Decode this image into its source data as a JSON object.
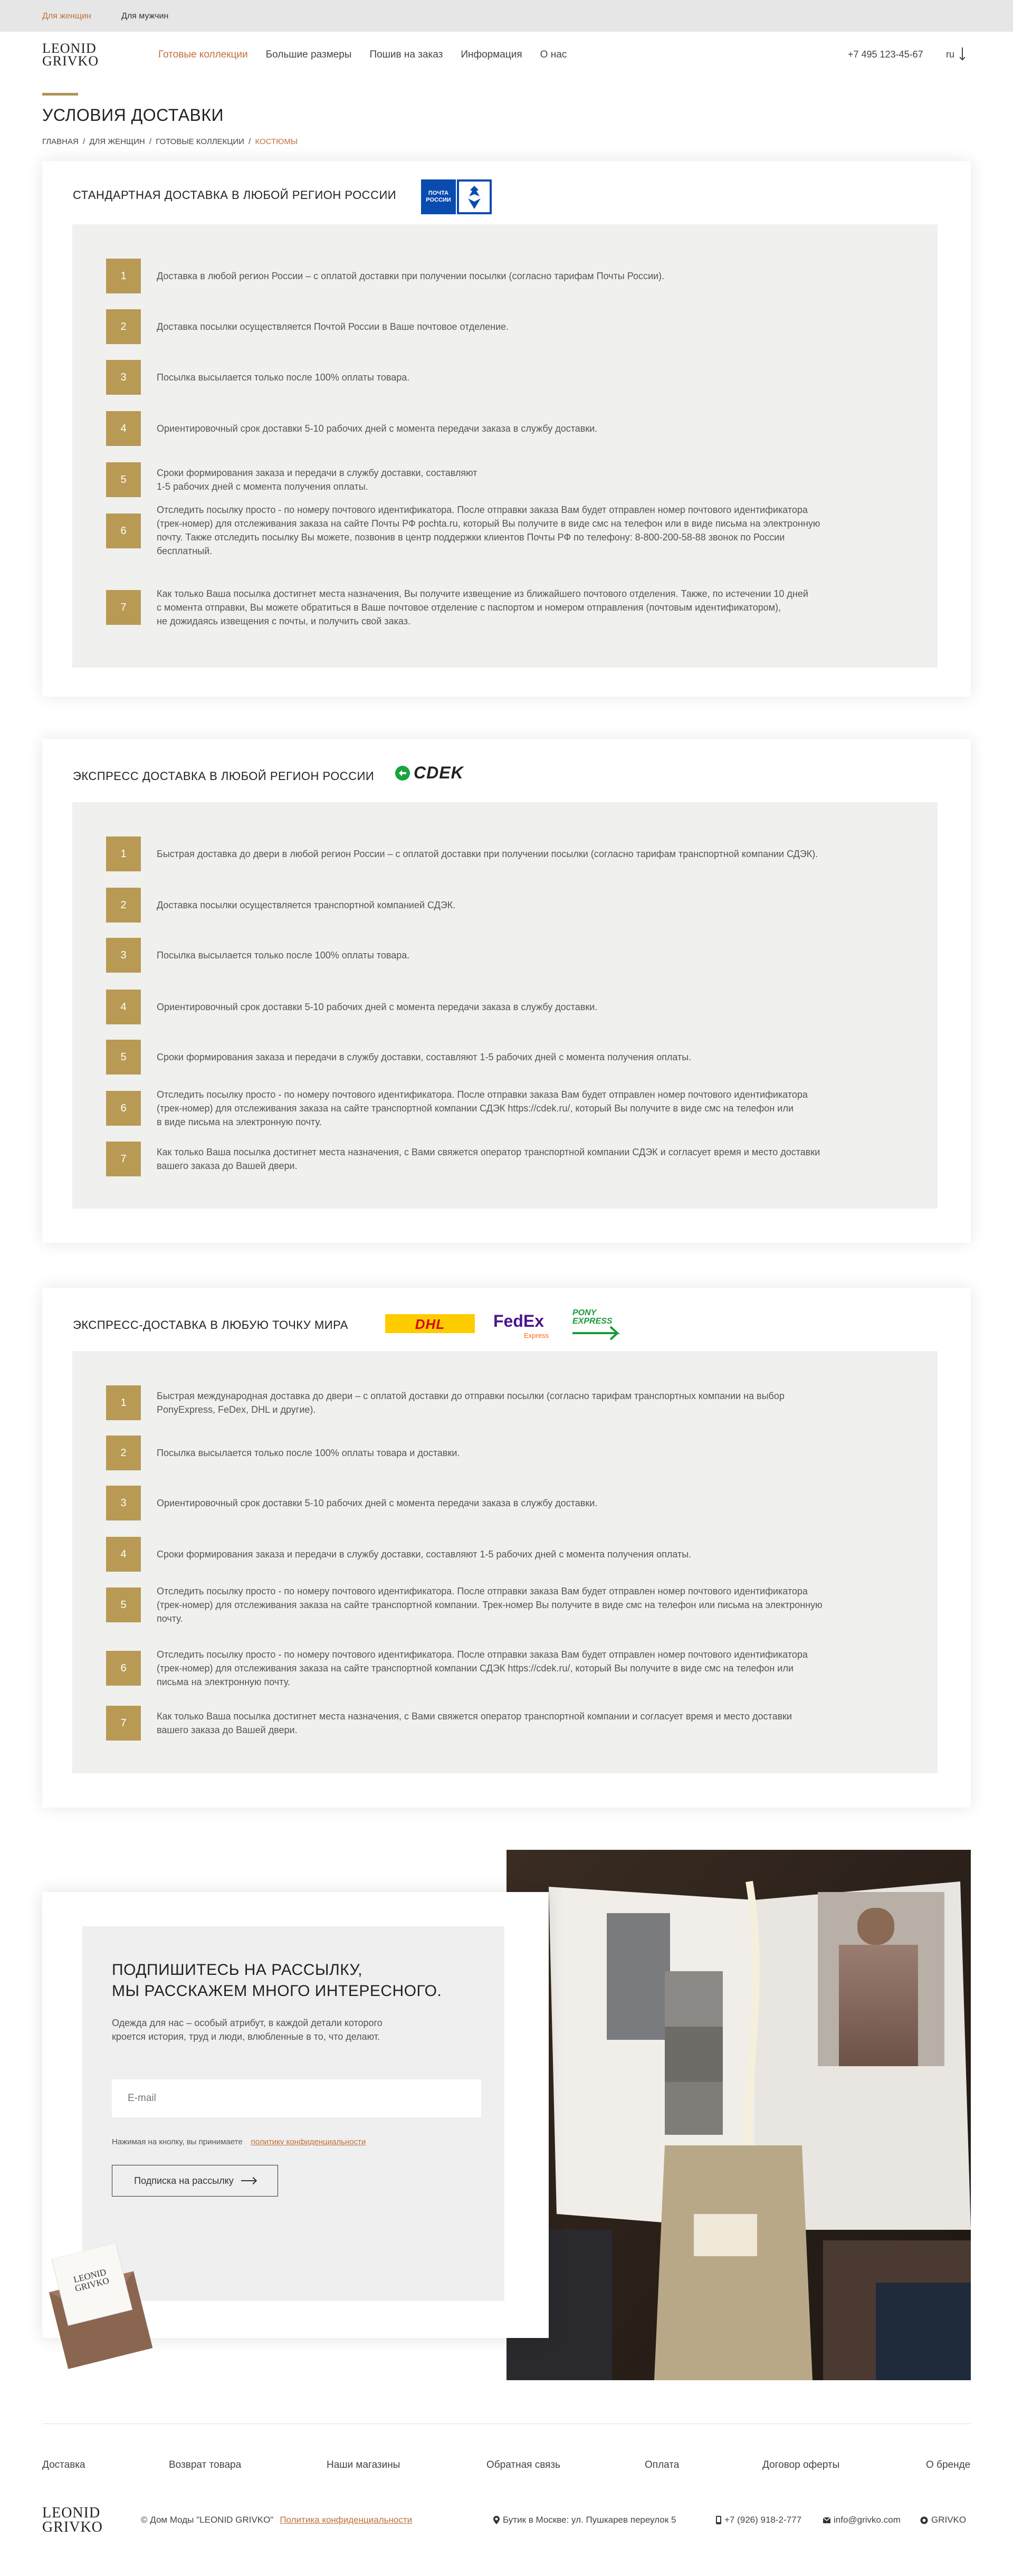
{
  "topbar": {
    "women": "Для женщин",
    "men": "Для мужчин"
  },
  "header": {
    "logo_line1": "LEONID",
    "logo_line2": "GRIVKO",
    "nav": [
      "Готовые коллекции",
      "Большие размеры",
      "Пошив на заказ",
      "Информация",
      "О нас"
    ],
    "phone": "+7 495 123-45-67",
    "lang": "ru"
  },
  "page": {
    "title": "УСЛОВИЯ ДОСТАВКИ",
    "breadcrumb": [
      "ГЛАВНАЯ",
      "ДЛЯ ЖЕНЩИН",
      "ГОТОВЫЕ КОЛЛЕКЦИИ",
      "КОСТЮМЫ"
    ],
    "breadcrumb_sep": "/"
  },
  "sections": [
    {
      "title": "СТАНДАРТНАЯ ДОСТАВКА В ЛЮБОЙ РЕГИОН РОССИИ",
      "logo_text": [
        "ПОЧТА",
        "РОССИИ"
      ],
      "steps": [
        {
          "num": "1",
          "lines": [
            "Доставка в любой регион России – с оплатой доставки при получении посылки (согласно тарифам Почты России)."
          ]
        },
        {
          "num": "2",
          "lines": [
            "Доставка посылки осуществляется Почтой России в Ваше почтовое отделение."
          ]
        },
        {
          "num": "3",
          "lines": [
            "Посылка высылается только после 100% оплаты товара."
          ]
        },
        {
          "num": "4",
          "lines": [
            "Ориентировочный срок доставки 5-10 рабочих дней с момента передачи заказа в службу доставки."
          ]
        },
        {
          "num": "5",
          "lines": [
            "Сроки формирования заказа и передачи в службу доставки, составляют",
            "1-5 рабочих дней с момента получения оплаты."
          ]
        },
        {
          "num": "6",
          "lines": [
            "Отследить посылку просто - по номеру почтового идентификатора. После отправки заказа Вам будет отправлен номер почтового идентификатора",
            "(трек-номер) для отслеживания заказа на сайте Почты РФ pochta.ru, который Вы получите в виде смс на телефон или в виде письма на электронную",
            "почту. Также отследить посылку Вы можете, позвонив в центр поддержки клиентов Почты РФ по телефону: 8-800-200-58-88 звонок по России",
            "бесплатный."
          ]
        },
        {
          "num": "7",
          "lines": [
            "Как только Ваша посылка достигнет места назначения, Вы получите извещение из ближайшего почтового отделения. Также, по истечении 10 дней",
            "с момента отправки, Вы можете обратиться в Ваше почтовое отделение с паспортом и номером отправления (почтовым идентификатором),",
            "не дожидаясь извещения с почты, и получить свой заказ."
          ]
        }
      ]
    },
    {
      "title": "ЭКСПРЕСС ДОСТАВКА В ЛЮБОЙ  РЕГИОН РОССИИ",
      "logo_text": [
        "CDEK"
      ],
      "steps": [
        {
          "num": "1",
          "lines": [
            "Быстрая доставка до двери в любой регион России – с оплатой доставки при получении посылки (согласно тарифам транспортной компании СДЭК)."
          ]
        },
        {
          "num": "2",
          "lines": [
            "Доставка посылки осуществляется транспортной компанией СДЭК."
          ]
        },
        {
          "num": "3",
          "lines": [
            "Посылка высылается только после 100% оплаты товара."
          ]
        },
        {
          "num": "4",
          "lines": [
            "Ориентировочный срок доставки 5-10 рабочих дней с момента передачи заказа в службу доставки."
          ]
        },
        {
          "num": "5",
          "lines": [
            "Сроки формирования заказа и передачи в службу доставки, составляют 1-5 рабочих дней с момента получения оплаты."
          ]
        },
        {
          "num": "6",
          "lines": [
            "Отследить посылку просто - по номеру почтового идентификатора. После отправки заказа Вам будет отправлен номер почтового идентификатора",
            "(трек-номер) для отслеживания заказа на сайте транспортной компании СДЭК https://cdek.ru/, который Вы получите в виде смс на телефон или",
            "в виде письма на электронную почту."
          ]
        },
        {
          "num": "7",
          "lines": [
            "Как только Ваша посылка достигнет места назначения, с Вами свяжется  оператор  транспортной компании СДЭК и согласует время и место доставки",
            "вашего заказа до Вашей двери."
          ]
        }
      ]
    },
    {
      "title": "ЭКСПРЕСС-ДОСТАВКА В ЛЮБУЮ ТОЧКУ МИРА",
      "logo_text": [
        "DHL",
        "FedEx",
        "Express",
        "PONY",
        "EXPRESS"
      ],
      "steps": [
        {
          "num": "1",
          "lines": [
            "Быстрая международная доставка до двери – с оплатой доставки до отправки посылки (согласно тарифам транспортных компании на выбор",
            "PonyExpress, FeDex, DHL и другие)."
          ]
        },
        {
          "num": "2",
          "lines": [
            "Посылка высылается только после 100% оплаты товара и доставки."
          ]
        },
        {
          "num": "3",
          "lines": [
            "Ориентировочный срок доставки 5-10 рабочих дней с момента передачи заказа в службу доставки."
          ]
        },
        {
          "num": "4",
          "lines": [
            "Сроки формирования заказа и передачи в службу доставки, составляют 1-5 рабочих дней с момента получения оплаты."
          ]
        },
        {
          "num": "5",
          "lines": [
            "Отследить посылку просто - по номеру почтового идентификатора. После отправки заказа Вам будет отправлен номер почтового идентификатора",
            "(трек-номер) для отслеживания заказа на сайте транспортной компании. Трек-номер Вы получите в виде смс на телефон или письма на электронную",
            "почту."
          ]
        },
        {
          "num": "6",
          "lines": [
            "Отследить посылку просто - по номеру почтового идентификатора. После отправки заказа Вам будет отправлен номер почтового идентификатора",
            "(трек-номер) для отслеживания заказа на сайте транспортной компании СДЭК https://cdek.ru/, который Вы получите в виде смс на телефон или",
            "письма на электронную почту."
          ]
        },
        {
          "num": "7",
          "lines": [
            "Как только Ваша посылка достигнет места назначения, с Вами свяжется  оператор  транспортной компании и согласует время и место доставки",
            "вашего заказа до Вашей двери."
          ]
        }
      ]
    }
  ],
  "subscribe": {
    "title_line1": "ПОДПИШИТЕСЬ НА РАССЫЛКУ,",
    "title_line2": "МЫ РАССКАЖЕМ МНОГО ИНТЕРЕСНОГО.",
    "desc_line1": "Одежда для нас – особый атрибут, в каждой детали которого",
    "desc_line2": "кроется история, труд и люди, влюбленные в то, что делают.",
    "email_placeholder": "E-mail",
    "consent_text": "Нажимая на кнопку, вы принимаете",
    "consent_link": "политику конфиденциальности",
    "button": "Подписка на рассылку",
    "envelope_logo1": "LEONID",
    "envelope_logo2": "GRIVKO"
  },
  "footer": {
    "nav": [
      "Доставка",
      "Возврат товара",
      "Наши магазины",
      "Обратная связь",
      "Оплата",
      "Договор оферты",
      "О бренде"
    ],
    "logo_line1": "LEONID",
    "logo_line2": "GRIVKO",
    "copyright": "© Дом Моды \"LEONID GRIVKO\"",
    "privacy": "Политика конфиденциальности",
    "address": "Бутик в Москве: ул. Пушкарев переулок 5",
    "phone": "+7 (926) 918-2-777",
    "email": "info@grivko.com",
    "brand": "GRIVKO"
  },
  "colors": {
    "accent": "#c0703a",
    "gold": "#b89a54",
    "panel": "#f0f0ef"
  }
}
